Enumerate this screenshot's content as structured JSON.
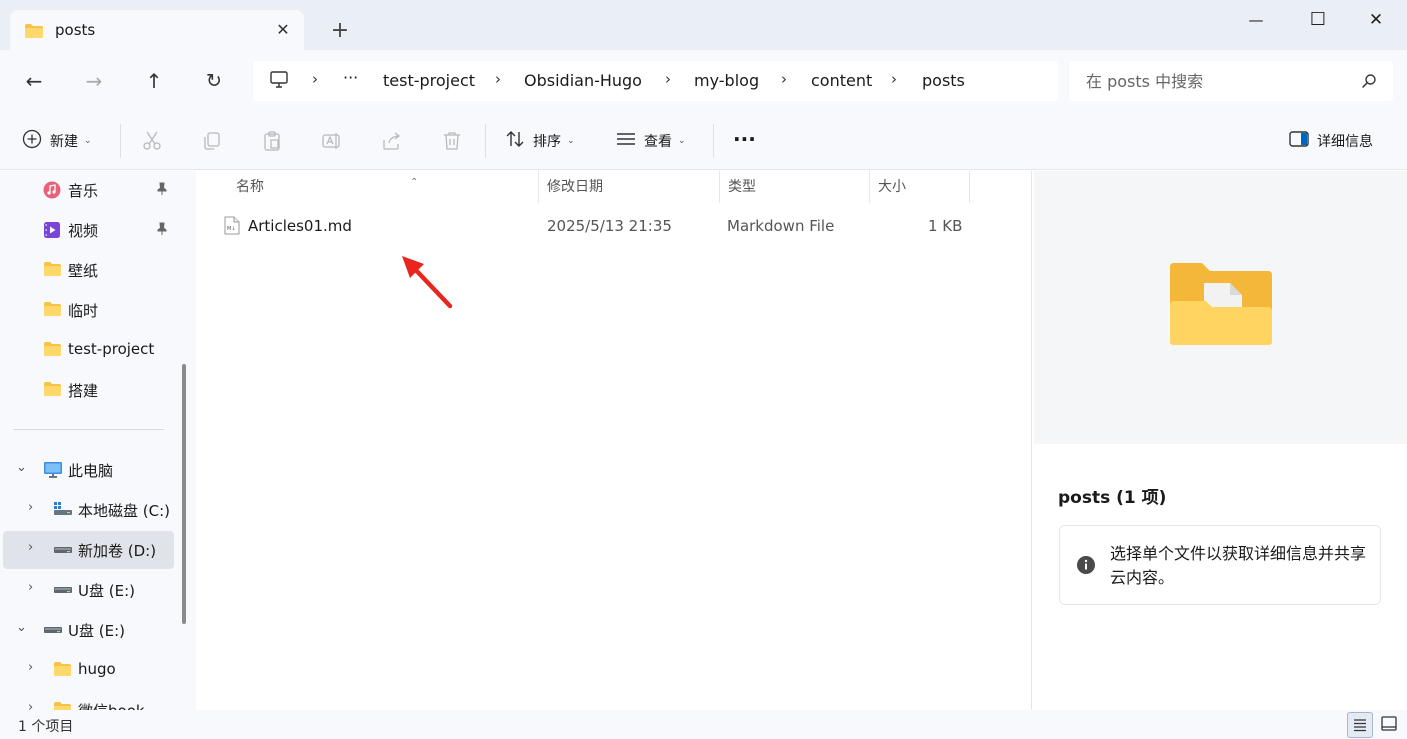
{
  "window": {
    "tab_title": "posts",
    "tab_close": "✕",
    "new_tab": "+",
    "minimize": "—",
    "maximize": "☐",
    "close": "✕"
  },
  "navigation": {
    "back": "←",
    "forward": "→",
    "up": "↑",
    "refresh": "↻",
    "overflow": "···",
    "breadcrumb": [
      "test-project",
      "Obsidian-Hugo",
      "my-blog",
      "content",
      "posts"
    ],
    "separator": "›"
  },
  "search": {
    "placeholder": "在 posts 中搜索"
  },
  "toolbar": {
    "new_label": "新建",
    "sort_label": "排序",
    "view_label": "查看",
    "more_label": "···",
    "details_label": "详细信息",
    "caret": "⌄"
  },
  "sidebar": {
    "quick_access": [
      {
        "label": "音乐",
        "icon": "music-icon",
        "pinned": true
      },
      {
        "label": "视频",
        "icon": "video-icon",
        "pinned": true
      },
      {
        "label": "壁纸",
        "icon": "folder-icon"
      },
      {
        "label": "临时",
        "icon": "folder-icon"
      },
      {
        "label": "test-project",
        "icon": "folder-icon"
      },
      {
        "label": "搭建",
        "icon": "folder-icon"
      }
    ],
    "this_pc": "此电脑",
    "drives": [
      {
        "label": "本地磁盘 (C:)",
        "icon": "windows-drive-icon"
      },
      {
        "label": "新加卷 (D:)",
        "icon": "drive-icon",
        "selected": true
      },
      {
        "label": "U盘 (E:)",
        "icon": "drive-icon"
      }
    ],
    "usb_root": "U盘 (E:)",
    "usb_children": [
      "hugo",
      "微信book"
    ],
    "expand_chevron": "›",
    "collapse_chevron": "⌄"
  },
  "columns": {
    "name": "名称",
    "modified": "修改日期",
    "type": "类型",
    "size": "大小",
    "sort_caret": "⌃"
  },
  "files": [
    {
      "name": "Articles01.md",
      "modified": "2025/5/13 21:35",
      "type": "Markdown File",
      "size": "1 KB",
      "icon": "markdown-file-icon"
    }
  ],
  "details": {
    "title": "posts (1 项)",
    "info": "选择单个文件以获取详细信息并共享云内容。"
  },
  "status": {
    "item_count": "1 个项目"
  },
  "colors": {
    "accent": "#0067c0",
    "folder": "#f6c344",
    "annotation": "#e8261e"
  }
}
